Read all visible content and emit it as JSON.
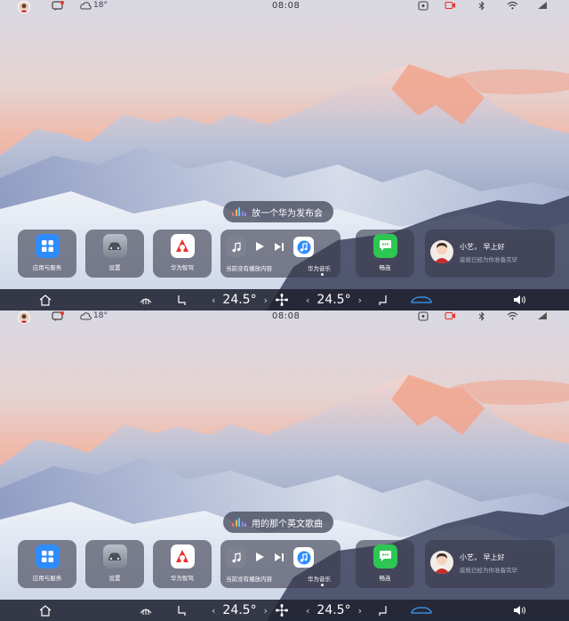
{
  "screens": [
    {
      "status": {
        "time": "08:08",
        "temperature": "18°"
      },
      "voice_text": "放一个华为发布会",
      "apps": [
        {
          "label": "应用与服务",
          "icon": "grid-icon",
          "color": "#2f8cff"
        },
        {
          "label": "设置",
          "icon": "car-settings-icon",
          "color": "#9aa0aa"
        },
        {
          "label": "华为智驾",
          "icon": "huawei-drive-icon",
          "color": "#e8322d"
        }
      ],
      "media": {
        "text": "当前没有播放内容",
        "app_label": "华为音乐"
      },
      "connect_label": "畅连",
      "assistant": {
        "greeting": "小艺， 早上好",
        "subtitle": "座舱已经为你准备完毕"
      },
      "climate": {
        "left_temp": "24.5°",
        "right_temp": "24.5°"
      }
    },
    {
      "status": {
        "time": "08:08",
        "temperature": "18°"
      },
      "voice_text": "用的那个英文歌曲",
      "apps": [
        {
          "label": "应用与服务",
          "icon": "grid-icon",
          "color": "#2f8cff"
        },
        {
          "label": "设置",
          "icon": "car-settings-icon",
          "color": "#9aa0aa"
        },
        {
          "label": "华为智驾",
          "icon": "huawei-drive-icon",
          "color": "#e8322d"
        }
      ],
      "media": {
        "text": "当前没有播放内容",
        "app_label": "华为音乐"
      },
      "connect_label": "畅连",
      "assistant": {
        "greeting": "小艺， 早上好",
        "subtitle": "座舱已经为你准备完毕"
      },
      "climate": {
        "left_temp": "24.5°",
        "right_temp": "24.5°"
      }
    }
  ],
  "colors": {
    "accent_blue": "#2f8cff",
    "connect_green": "#2dc653",
    "huawei_red": "#e8322d",
    "bar_bg": "#202230"
  }
}
